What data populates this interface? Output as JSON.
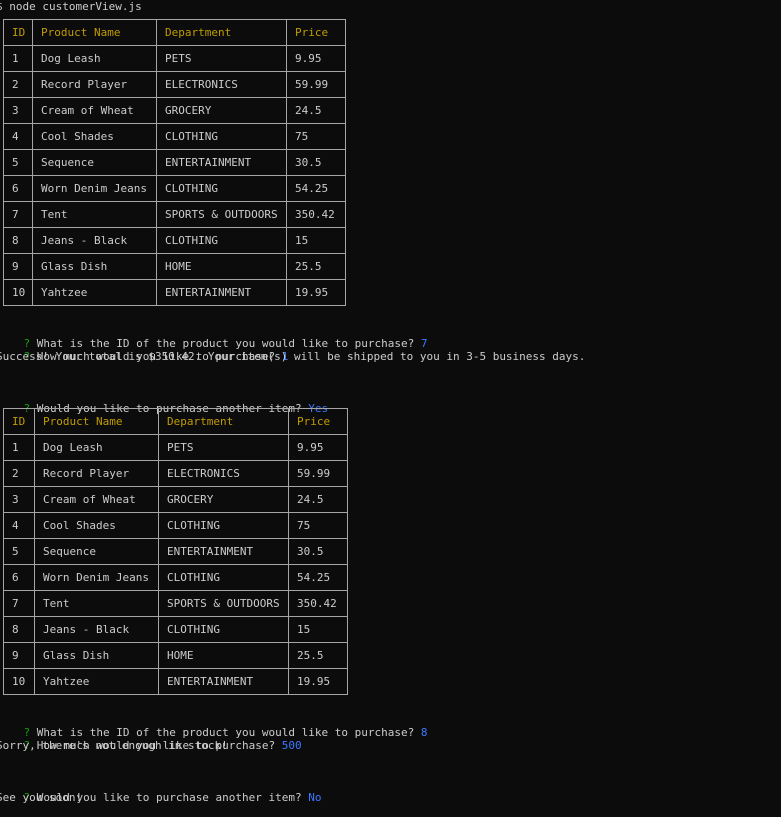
{
  "terminal": {
    "command_line": "$ node customerView.js"
  },
  "table_headers": [
    "ID",
    "Product Name",
    "Department",
    "Price"
  ],
  "products": [
    {
      "id": "1",
      "name": "Dog Leash",
      "department": "PETS",
      "price": "9.95"
    },
    {
      "id": "2",
      "name": "Record Player",
      "department": "ELECTRONICS",
      "price": "59.99"
    },
    {
      "id": "3",
      "name": "Cream of Wheat",
      "department": "GROCERY",
      "price": "24.5"
    },
    {
      "id": "4",
      "name": "Cool Shades",
      "department": "CLOTHING",
      "price": "75"
    },
    {
      "id": "5",
      "name": "Sequence",
      "department": "ENTERTAINMENT",
      "price": "30.5"
    },
    {
      "id": "6",
      "name": "Worn Denim Jeans",
      "department": "CLOTHING",
      "price": "54.25"
    },
    {
      "id": "7",
      "name": "Tent",
      "department": "SPORTS & OUTDOORS",
      "price": "350.42"
    },
    {
      "id": "8",
      "name": "Jeans - Black",
      "department": "CLOTHING",
      "price": "15"
    },
    {
      "id": "9",
      "name": "Glass Dish",
      "department": "HOME",
      "price": "25.5"
    },
    {
      "id": "10",
      "name": "Yahtzee",
      "department": "ENTERTAINMENT",
      "price": "19.95"
    }
  ],
  "session1": {
    "q_id_mark": "?",
    "q_id": " What is the ID of the product you would like to purchase? ",
    "a_id": "7",
    "q_qty_mark": "?",
    "q_qty": " How much would you like to purchase? ",
    "a_qty": "1",
    "result": "Success! Your total is $350.42. Your item(s) will be shipped to you in 3-5 business days.",
    "q_again_mark": "?",
    "q_again": " Would you like to purchase another item? ",
    "a_again": "Yes"
  },
  "session2": {
    "q_id_mark": "?",
    "q_id": " What is the ID of the product you would like to purchase? ",
    "a_id": "8",
    "q_qty_mark": "?",
    "q_qty": " How much would you like to purchase? ",
    "a_qty": "500",
    "result": "Sorry, there's not enough in stock!",
    "q_again_mark": "?",
    "q_again": " Would you like to purchase another item? ",
    "a_again": "No",
    "farewell": "See you soon!"
  },
  "colors": {
    "background": "#0c0c0c",
    "text": "#cccccc",
    "header_text": "#c19c00",
    "prompt_mark": "#13a10e",
    "answer": "#3b78ff",
    "table_border": "#a6a6a6"
  }
}
